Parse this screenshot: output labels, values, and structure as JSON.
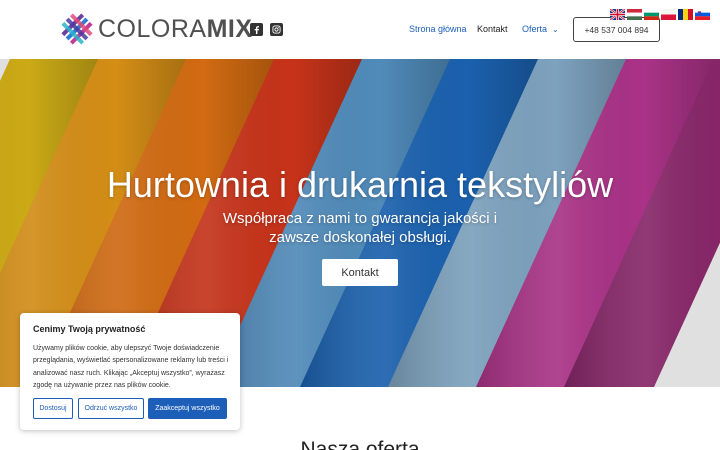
{
  "header": {
    "logo": {
      "text_regular": "COLORA",
      "text_bold": "MIX"
    },
    "social": [
      {
        "icon": "facebook-icon"
      },
      {
        "icon": "instagram-icon"
      }
    ],
    "nav": {
      "home": "Strona główna",
      "contact": "Kontakt",
      "offer": "Oferta",
      "offer_chevron": "⌄"
    },
    "phone": "+48 537 004 894",
    "languages": [
      "English",
      "Hungarian",
      "Bulgarian",
      "Polish",
      "Romanian",
      "Slovenian"
    ]
  },
  "hero": {
    "title": "Hurtownia i drukarnia tekstyliów",
    "subtitle": "Współpraca z nami to gwarancja jakości i zawsze doskonałej obsługi.",
    "button": "Kontakt",
    "fabric_colors": [
      "#e8c21a",
      "#f2a21a",
      "#ef7a15",
      "#e23b1e",
      "#5c9fd4",
      "#1f6fc7",
      "#8fb9d9",
      "#c23a9a",
      "#9b2c78"
    ]
  },
  "section": {
    "title": "Nasza oferta"
  },
  "cookie": {
    "title": "Cenimy Twoją prywatność",
    "text": "Używamy plików cookie, aby ulepszyć Twoje doświadczenie przeglądania, wyświetlać spersonalizowane reklamy lub treści i analizować nasz ruch. Klikając „Akceptuj wszystko”, wyrażasz zgodę na używanie przez nas plików cookie.",
    "customize": "Dostosuj",
    "reject": "Odrzuć wszystko",
    "accept": "Zaakceptuj wszystko"
  },
  "colors": {
    "accent": "#1d5fb8"
  }
}
